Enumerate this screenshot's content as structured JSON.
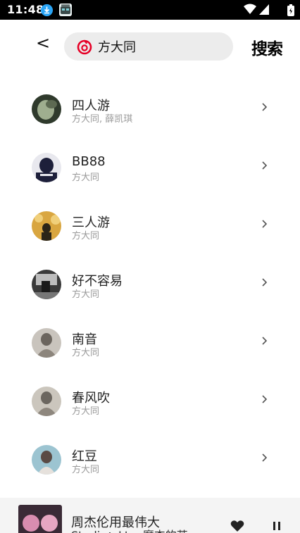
{
  "status_bar": {
    "time": "11:48",
    "icons": [
      "download-icon",
      "app-icon",
      "wifi-icon",
      "signal-icon",
      "battery-icon"
    ]
  },
  "header": {
    "back_label": "<",
    "search_value": "方大同",
    "search_button": "搜索",
    "accent_color": "#e60026"
  },
  "results": [
    {
      "title": "四人游",
      "artist": "方大同, 薛凯琪",
      "cover_colors": [
        "#2f3a2c",
        "#9fae8f"
      ]
    },
    {
      "title": "BB88",
      "artist": "方大同",
      "cover_colors": [
        "#1d1f3a",
        "#e8e8ee"
      ]
    },
    {
      "title": "三人游",
      "artist": "方大同",
      "cover_colors": [
        "#d9a640",
        "#2a2418"
      ]
    },
    {
      "title": "好不容易",
      "artist": "方大同",
      "cover_colors": [
        "#3a3a3a",
        "#bdbdbd"
      ]
    },
    {
      "title": "南音",
      "artist": "方大同",
      "cover_colors": [
        "#c9c4bd",
        "#6b655e"
      ]
    },
    {
      "title": "春风吹",
      "artist": "方大同",
      "cover_colors": [
        "#cbc6bd",
        "#6b665f"
      ]
    },
    {
      "title": "红豆",
      "artist": "方大同",
      "cover_colors": [
        "#9cc4d1",
        "#5a4a44"
      ]
    }
  ],
  "player": {
    "title": "周杰伦用最伟大",
    "subtitle": "Studio：Ltoo摩杰的苦",
    "cover_colors": [
      "#3a2a36",
      "#d98db0"
    ]
  }
}
